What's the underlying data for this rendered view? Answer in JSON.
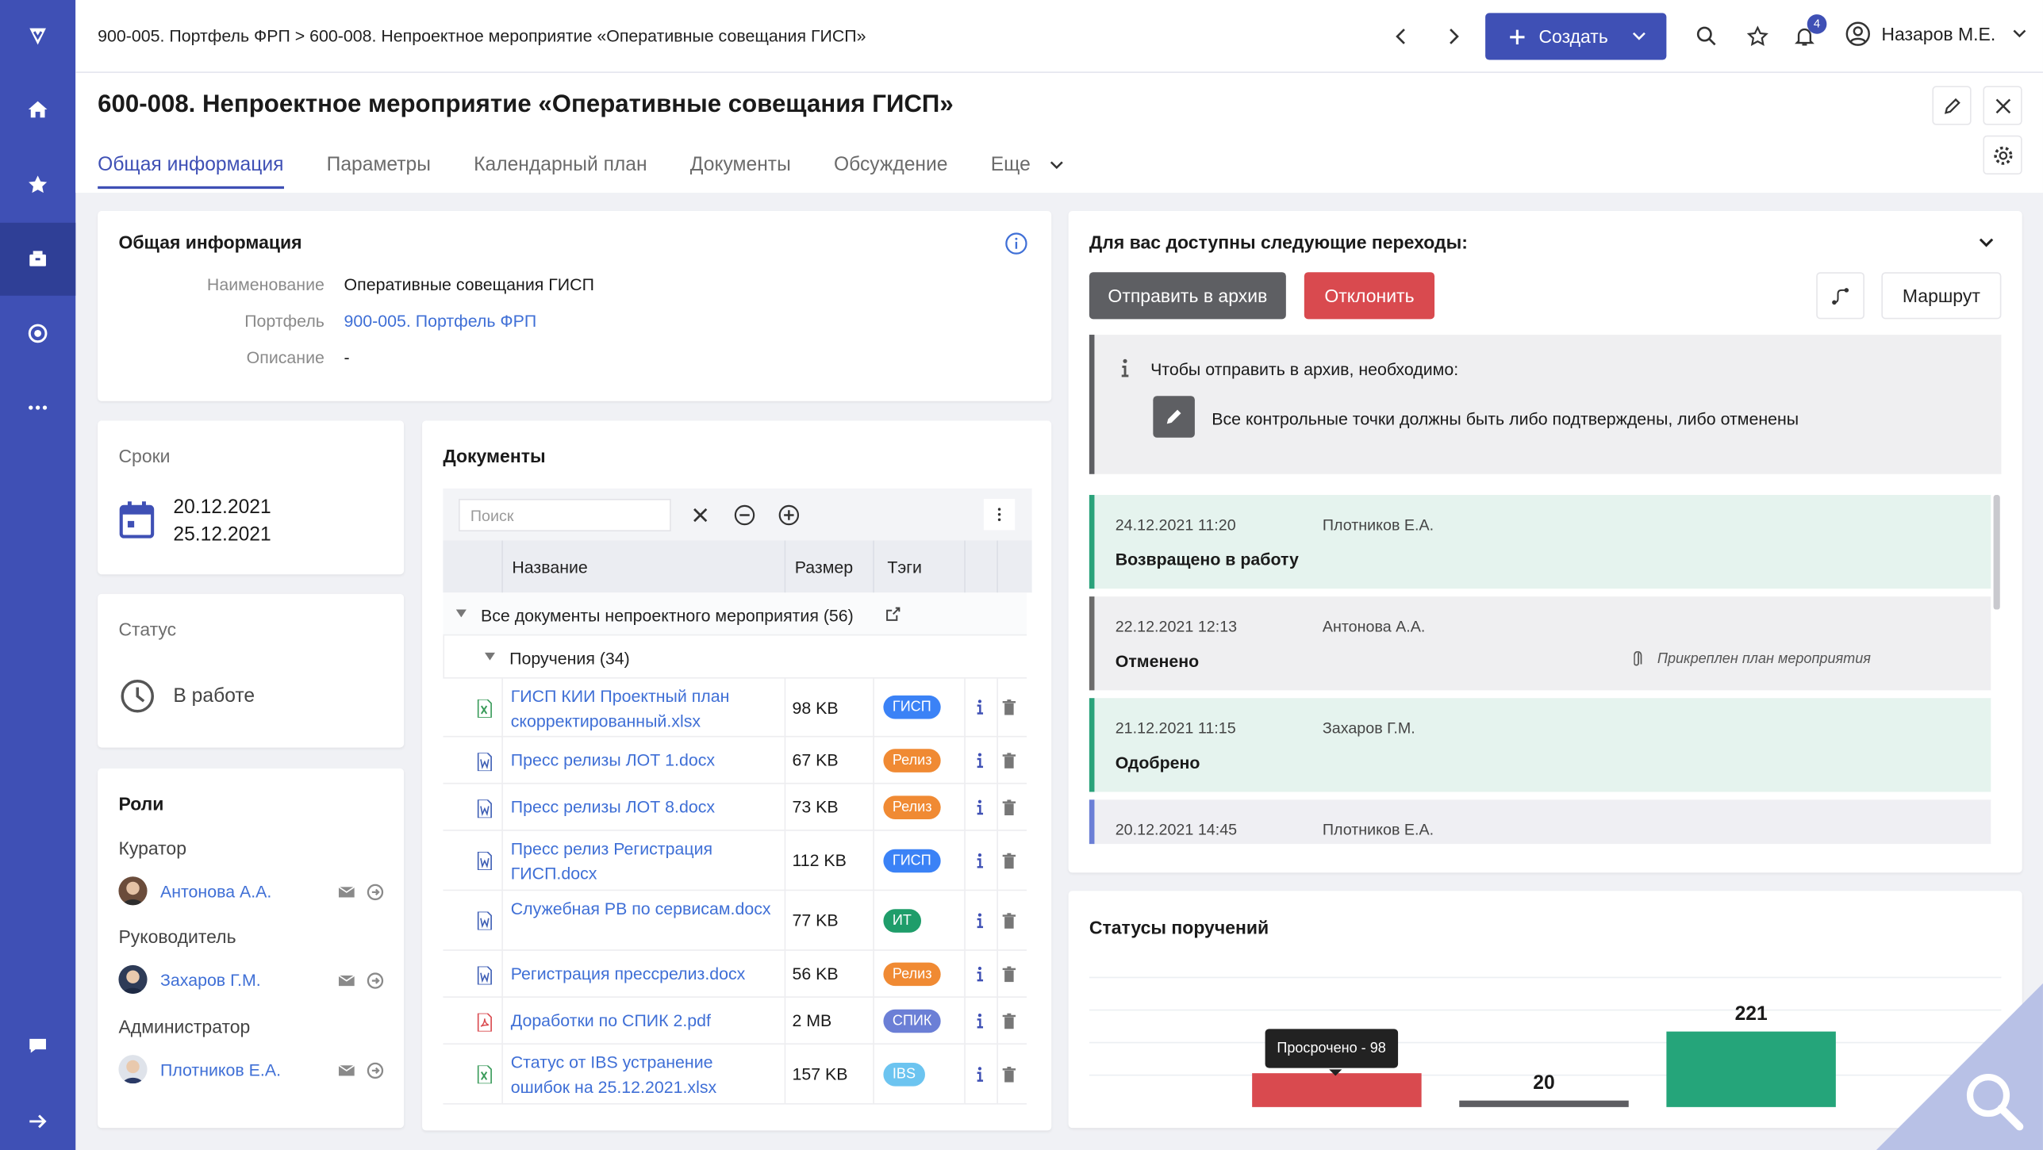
{
  "topbar": {
    "breadcrumb": "900-005. Портфель ФРП > 600-008. Непроектное мероприятие «Оперативные совещания ГИСП»",
    "create_label": "Создать",
    "notifications_count": "4",
    "user_name": "Назаров М.Е."
  },
  "header": {
    "title": "600-008. Непроектное мероприятие «Оперативные совещания ГИСП»",
    "tabs": [
      {
        "label": "Общая информация"
      },
      {
        "label": "Параметры"
      },
      {
        "label": "Календарный план"
      },
      {
        "label": "Документы"
      },
      {
        "label": "Обсуждение"
      },
      {
        "label": "Еще"
      }
    ]
  },
  "general": {
    "heading": "Общая информация",
    "name_label": "Наименование",
    "name_value": "Оперативные совещания ГИСП",
    "portfolio_label": "Портфель",
    "portfolio_value": "900-005. Портфель ФРП",
    "description_label": "Описание",
    "description_value": "-"
  },
  "dates": {
    "heading": "Сроки",
    "start": "20.12.2021",
    "end": "25.12.2021"
  },
  "status": {
    "heading": "Статус",
    "value": "В работе"
  },
  "roles": {
    "heading": "Роли",
    "items": [
      {
        "role": "Куратор",
        "person": "Антонова А.А."
      },
      {
        "role": "Руководитель",
        "person": "Захаров Г.М."
      },
      {
        "role": "Администратор",
        "person": "Плотников Е.А."
      }
    ]
  },
  "documents": {
    "heading": "Документы",
    "search_placeholder": "Поиск",
    "columns": {
      "name": "Название",
      "size": "Размер",
      "tags": "Тэги"
    },
    "group": "Все документы непроектного мероприятия (56)",
    "subgroup": "Поручения (34)",
    "files": [
      {
        "name": "ГИСП КИИ Проектный план скорректированный.xlsx",
        "size": "98 KB",
        "tag": "ГИСП",
        "tag_color": "#3b82f6",
        "type": "xlsx"
      },
      {
        "name": "Пресс релизы ЛОТ 1.docx",
        "size": "67 KB",
        "tag": "Релиз",
        "tag_color": "#f08a33",
        "type": "docx"
      },
      {
        "name": "Пресс релизы ЛОТ 8.docx",
        "size": "73 KB",
        "tag": "Релиз",
        "tag_color": "#f08a33",
        "type": "docx"
      },
      {
        "name": "Пресс релиз Регистрация ГИСП.docx",
        "size": "112 KB",
        "tag": "ГИСП",
        "tag_color": "#3b82f6",
        "type": "docx"
      },
      {
        "name": "Служебная РВ по сервисам.docx",
        "size": "77 KB",
        "tag": "ИТ",
        "tag_color": "#1f9d6a",
        "type": "docx"
      },
      {
        "name": "Регистрация прессрелиз.docx",
        "size": "56 KB",
        "tag": "Релиз",
        "tag_color": "#f08a33",
        "type": "docx"
      },
      {
        "name": "Доработки по СПИК 2.pdf",
        "size": "2 MB",
        "tag": "СПИК",
        "tag_color": "#6b7fd6",
        "type": "pdf"
      },
      {
        "name": "Статус от IBS устранение ошибок на 25.12.2021.xlsx",
        "size": "157 KB",
        "tag": "IBS",
        "tag_color": "#6cc4f0",
        "type": "xlsx"
      }
    ]
  },
  "transitions": {
    "heading": "Для вас доступны следующие переходы:",
    "archive_label": "Отправить в архив",
    "reject_label": "Отклонить",
    "route_label": "Маршрут",
    "notice_title": "Чтобы отправить в архив, необходимо:",
    "notice_item": "Все контрольные точки должны быть либо подтверждены, либо отменены",
    "history": [
      {
        "date": "24.12.2021 11:20",
        "who": "Плотников Е.А.",
        "status": "Возвращено в работу",
        "note": "",
        "color": "#2aa27a",
        "bg": "#e5f3ee"
      },
      {
        "date": "22.12.2021 12:13",
        "who": "Антонова А.А.",
        "status": "Отменено",
        "note": "Прикреплен план мероприятия",
        "color": "#6b6b6b",
        "bg": "#efeff1"
      },
      {
        "date": "21.12.2021 11:15",
        "who": "Захаров Г.М.",
        "status": "Одобрено",
        "note": "",
        "color": "#2aa27a",
        "bg": "#e5f3ee"
      },
      {
        "date": "20.12.2021 14:45",
        "who": "Плотников Е.А.",
        "status": "",
        "note": "",
        "color": "#6b7fd6",
        "bg": "#efeff3"
      }
    ]
  },
  "statuses": {
    "heading": "Статусы поручений",
    "tooltip": "Просрочено - 98"
  },
  "chart_data": {
    "type": "bar",
    "categories": [
      "Просрочено",
      "",
      ""
    ],
    "values": [
      98,
      20,
      221
    ],
    "colors": [
      "#d94a4f",
      "#5e5e62",
      "#25a57a"
    ],
    "data_labels": [
      "",
      "20",
      "221"
    ]
  }
}
